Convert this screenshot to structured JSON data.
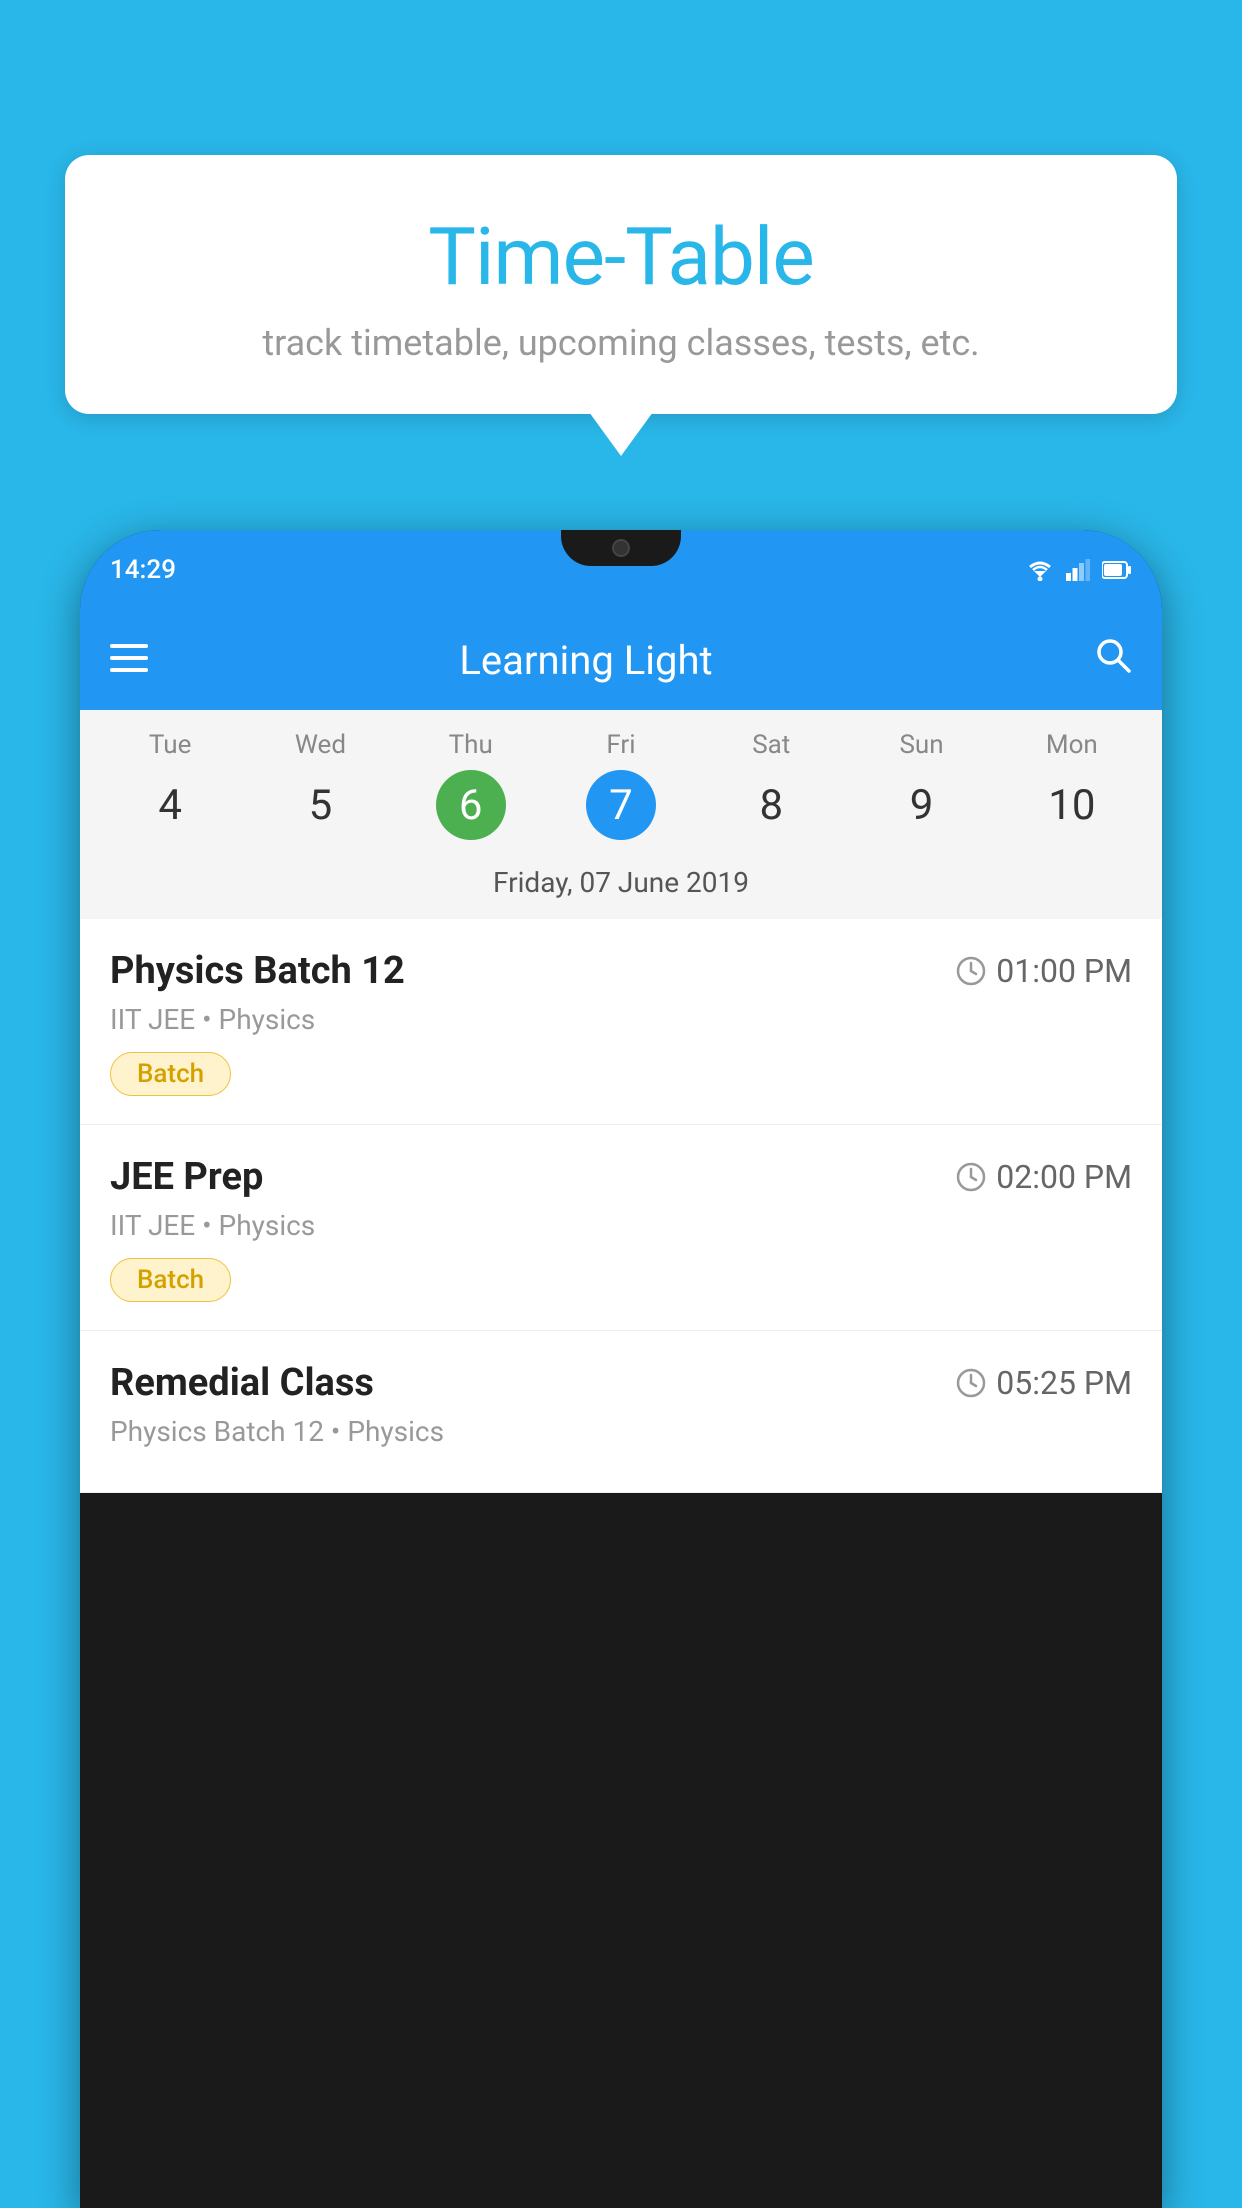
{
  "background_color": "#29B6E8",
  "bubble": {
    "title": "Time-Table",
    "subtitle": "track timetable, upcoming classes, tests, etc."
  },
  "phone": {
    "status_bar": {
      "time": "14:29"
    },
    "app_bar": {
      "title": "Learning Light"
    },
    "calendar": {
      "days": [
        {
          "name": "Tue",
          "number": "4",
          "state": "normal"
        },
        {
          "name": "Wed",
          "number": "5",
          "state": "normal"
        },
        {
          "name": "Thu",
          "number": "6",
          "state": "today"
        },
        {
          "name": "Fri",
          "number": "7",
          "state": "selected"
        },
        {
          "name": "Sat",
          "number": "8",
          "state": "normal"
        },
        {
          "name": "Sun",
          "number": "9",
          "state": "normal"
        },
        {
          "name": "Mon",
          "number": "10",
          "state": "normal"
        }
      ],
      "selected_date_label": "Friday, 07 June 2019"
    },
    "schedule": [
      {
        "title": "Physics Batch 12",
        "time": "01:00 PM",
        "meta": "IIT JEE • Physics",
        "badge": "Batch"
      },
      {
        "title": "JEE Prep",
        "time": "02:00 PM",
        "meta": "IIT JEE • Physics",
        "badge": "Batch"
      },
      {
        "title": "Remedial Class",
        "time": "05:25 PM",
        "meta": "Physics Batch 12 • Physics",
        "badge": null
      }
    ]
  }
}
